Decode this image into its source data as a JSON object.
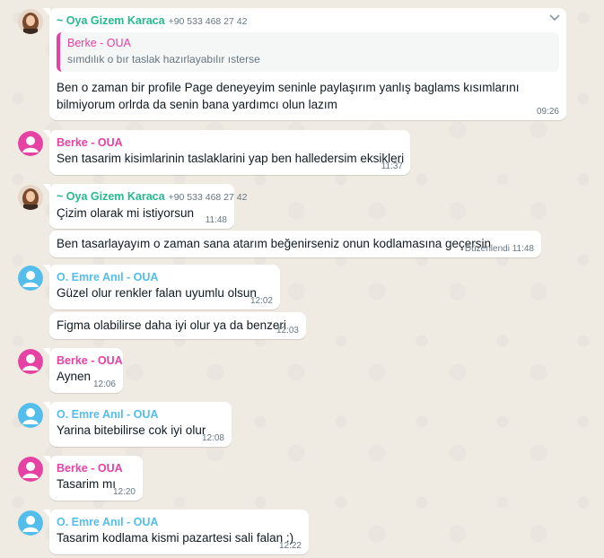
{
  "colors": {
    "oya": "#25b98f",
    "berke": "#e542a3",
    "emre": "#53bdeb"
  },
  "messages": [
    {
      "sender": "~ Oya Gizem Karaca",
      "phone": "+90 533 468 27 42",
      "quote": {
        "name": "Berke - OUA",
        "text": "sımdılık o bır taslak hazırlayabılır ısterse"
      },
      "text": "Ben o zaman bir profile Page deneyeyim seninle paylaşırım yanlış baglams kısımlarını bilmiyorum orlrda da senin bana yardımcı olun lazım",
      "time": "09:26"
    },
    {
      "sender": "Berke - OUA",
      "text": "Sen tasarim kisimlarinin taslaklarini yap ben halledersim eksikleri",
      "time": "11:37"
    },
    {
      "sender": "~ Oya Gizem Karaca",
      "phone": "+90 533 468 27 42",
      "text": "Çizim olarak mi istiyorsun",
      "time": "11:48"
    },
    {
      "text": "Ben tasarlayayım o zaman sana atarım beğenirseniz onun kodlamasına geçersin",
      "edited": "Düzenlendi",
      "time": "11:48"
    },
    {
      "sender": "O. Emre Anıl - OUA",
      "text": "Güzel olur renkler falan uyumlu olsun",
      "time": "12:02"
    },
    {
      "text": "Figma olabilirse daha iyi olur ya da benzeri",
      "time": "12:03"
    },
    {
      "sender": "Berke - OUA",
      "text": "Aynen",
      "time": "12:06"
    },
    {
      "sender": "O. Emre Anıl - OUA",
      "text": "Yarina bitebilirse cok iyi olur",
      "time": "12:08"
    },
    {
      "sender": "Berke - OUA",
      "text": "Tasarim mı",
      "time": "12:20"
    },
    {
      "sender": "O. Emre Anıl - OUA",
      "text": "Tasarim kodlama kismi pazartesi sali falan :)",
      "time": "12:22"
    }
  ]
}
